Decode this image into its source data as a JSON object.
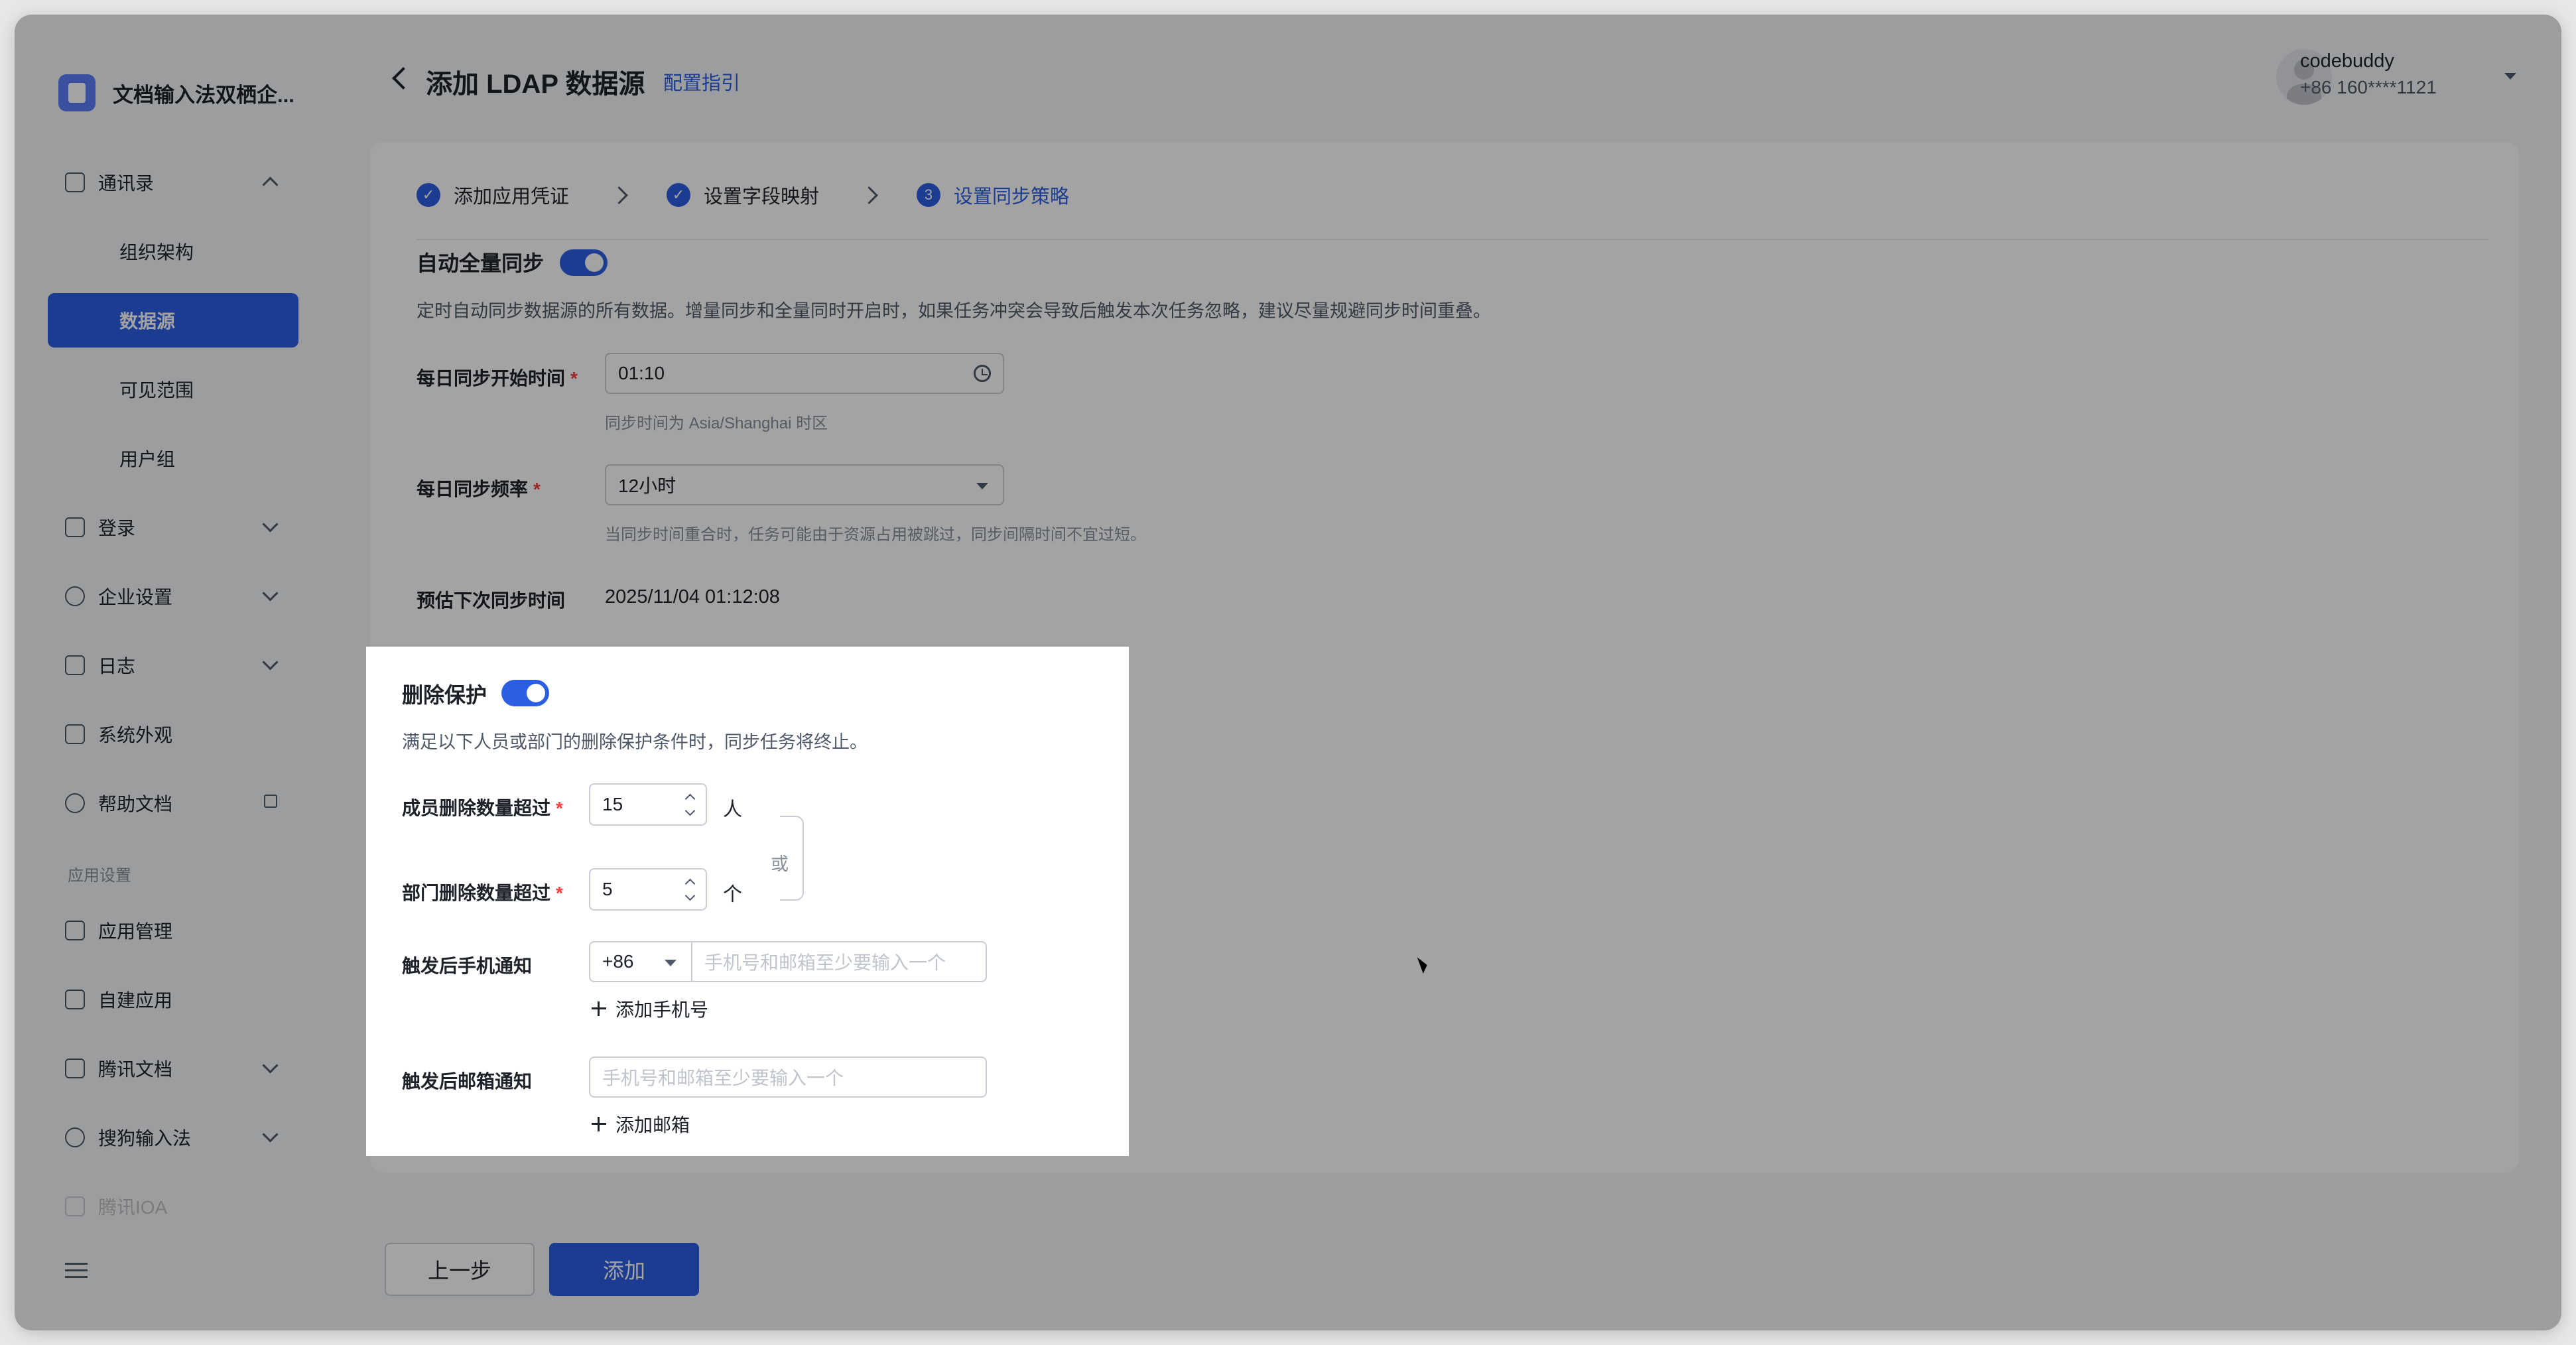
{
  "app": {
    "name": "文档输入法双栖企..."
  },
  "sidebar": {
    "items": [
      {
        "label": "通讯录"
      },
      {
        "label": "组织架构"
      },
      {
        "label": "数据源"
      },
      {
        "label": "可见范围"
      },
      {
        "label": "用户组"
      },
      {
        "label": "登录"
      },
      {
        "label": "企业设置"
      },
      {
        "label": "日志"
      },
      {
        "label": "系统外观"
      },
      {
        "label": "帮助文档"
      },
      {
        "label": "应用管理"
      },
      {
        "label": "自建应用"
      },
      {
        "label": "腾讯文档"
      },
      {
        "label": "搜狗输入法"
      },
      {
        "label": "腾讯IOA"
      }
    ],
    "group_label": "应用设置"
  },
  "header": {
    "title": "添加 LDAP 数据源",
    "guide_link": "配置指引",
    "user_name": "codebuddy",
    "user_phone": "+86 160****1121"
  },
  "steps": [
    {
      "label": "添加应用凭证",
      "status": "done"
    },
    {
      "label": "设置字段映射",
      "status": "done"
    },
    {
      "label": "设置同步策略",
      "number": "3",
      "status": "active"
    }
  ],
  "full_sync": {
    "title": "自动全量同步",
    "enabled": true,
    "description": "定时自动同步数据源的所有数据。增量同步和全量同时开启时，如果任务冲突会导致后触发本次任务忽略，建议尽量规避同步时间重叠。",
    "start_time_label": "每日同步开始时间",
    "start_time_value": "01:10",
    "start_time_hint": "同步时间为 Asia/Shanghai 时区",
    "frequency_label": "每日同步频率",
    "frequency_value": "12小时",
    "frequency_hint": "当同步时间重合时，任务可能由于资源占用被跳过，同步间隔时间不宜过短。",
    "next_sync_label": "预估下次同步时间",
    "next_sync_value": "2025/11/04 01:12:08"
  },
  "delete_protection": {
    "title": "删除保护",
    "enabled": true,
    "description": "满足以下人员或部门的删除保护条件时，同步任务将终止。",
    "member_label": "成员删除数量超过",
    "member_value": "15",
    "member_unit": "人",
    "or_text": "或",
    "dept_label": "部门删除数量超过",
    "dept_value": "5",
    "dept_unit": "个",
    "phone_label": "触发后手机通知",
    "country_code": "+86",
    "phone_placeholder": "手机号和邮箱至少要输入一个",
    "add_phone": "添加手机号",
    "email_label": "触发后邮箱通知",
    "email_placeholder": "手机号和邮箱至少要输入一个",
    "add_email": "添加邮箱"
  },
  "footer": {
    "prev_label": "上一步",
    "submit_label": "添加"
  },
  "colors": {
    "primary": "#2b5fe3",
    "required": "#f53f3f"
  }
}
